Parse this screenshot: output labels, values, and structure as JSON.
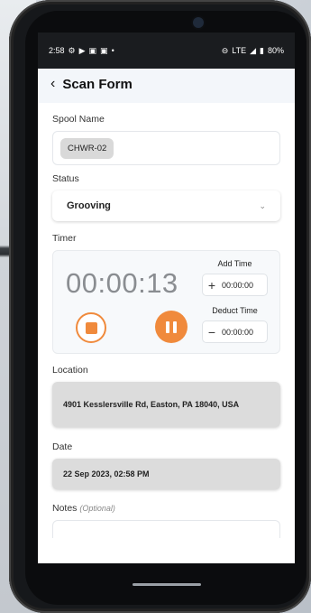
{
  "status_bar": {
    "time": "2:58",
    "network": "LTE",
    "battery": "80%"
  },
  "header": {
    "title": "Scan Form"
  },
  "form": {
    "spool_name": {
      "label": "Spool Name",
      "value": "CHWR-02"
    },
    "status": {
      "label": "Status",
      "value": "Grooving"
    },
    "timer": {
      "label": "Timer",
      "elapsed": "00:00:13",
      "add_time_label": "Add Time",
      "add_time_value": "00:00:00",
      "deduct_time_label": "Deduct Time",
      "deduct_time_value": "00:00:00"
    },
    "location": {
      "label": "Location",
      "value": "4901 Kesslersville Rd, Easton, PA 18040, USA"
    },
    "date": {
      "label": "Date",
      "value": "22 Sep 2023, 02:58 PM"
    },
    "notes": {
      "label": "Notes",
      "optional": "(Optional)"
    }
  },
  "colors": {
    "accent": "#f08a3c",
    "readonly_bg": "#dcdcdc"
  },
  "icons": {
    "back": "chevron-left-icon",
    "dropdown": "chevron-down-icon",
    "stop": "stop-icon",
    "pause": "pause-icon",
    "plus": "plus-icon",
    "minus": "minus-icon"
  }
}
